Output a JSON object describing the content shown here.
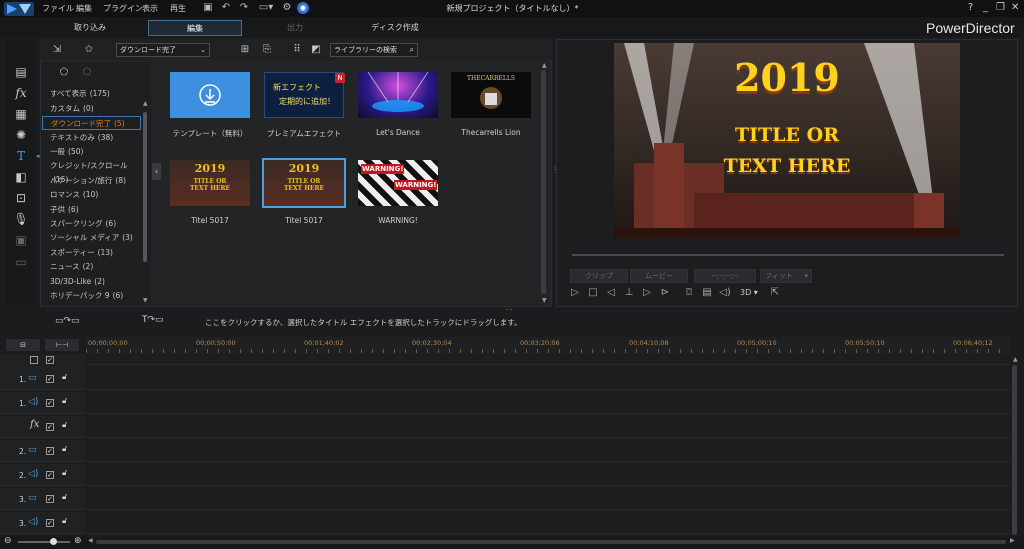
{
  "window": {
    "menu": [
      "ファイル",
      "編集",
      "プラグイン",
      "表示",
      "再生"
    ],
    "title": "新規プロジェクト（タイトルなし）*",
    "controls": [
      "?",
      "_",
      "❐",
      "✕"
    ]
  },
  "modes": {
    "capture": "取り込み",
    "edit": "編集",
    "produce": "出力",
    "disc": "ディスク作成"
  },
  "brand": "PowerDirector",
  "library": {
    "dropdown": "ダウンロード完了",
    "search_placeholder": "ライブラリーの検索",
    "categories": [
      {
        "label": "すべて表示",
        "count": "(175)"
      },
      {
        "label": "カスタム",
        "count": "(0)"
      },
      {
        "label": "ダウンロード完了",
        "count": "(5)",
        "selected": true
      },
      {
        "label": "テキストのみ",
        "count": "(38)"
      },
      {
        "label": "一般",
        "count": "(50)"
      },
      {
        "label": "クレジット/スクロール",
        "count": "(15)"
      },
      {
        "label": "バケーション/旅行",
        "count": "(8)"
      },
      {
        "label": "ロマンス",
        "count": "(10)"
      },
      {
        "label": "子供",
        "count": "(6)"
      },
      {
        "label": "スパークリング",
        "count": "(6)"
      },
      {
        "label": "ソーシャル メディア",
        "count": "(3)"
      },
      {
        "label": "スポーティー",
        "count": "(13)"
      },
      {
        "label": "ニュース",
        "count": "(2)"
      },
      {
        "label": "3D/3D-Like",
        "count": "(2)"
      },
      {
        "label": "ホリデーパック 9",
        "count": "(6)"
      }
    ],
    "items": [
      {
        "label": "テンプレート（無料）"
      },
      {
        "label": "プレミアムエフェクト",
        "line1": "新エフェクト",
        "line2": "定期的に追加！",
        "badge": "N"
      },
      {
        "label": "Let's Dance"
      },
      {
        "label": "Thecarrells Lion",
        "thumb_text": "THECARRELLS"
      },
      {
        "label": "Titel 5017",
        "thumb_text": [
          "2019",
          "TITLE OR",
          "TEXT HERE"
        ]
      },
      {
        "label": "Titel 5017",
        "thumb_text": [
          "2019",
          "TITLE OR",
          "TEXT HERE"
        ]
      },
      {
        "label": "WARNING!",
        "thumb_text": "WARNING!"
      }
    ]
  },
  "preview": {
    "year": "2019",
    "line1": "TITLE OR",
    "line2": "TEXT HERE",
    "clip_btn": "クリップ",
    "movie_btn": "ムービー",
    "timecode": "--;--;--;--",
    "fit": "フィット",
    "mode_3d": "3D"
  },
  "timeline": {
    "hint": "ここをクリックするか、選択したタイトル エフェクトを選択したトラックにドラッグします。",
    "ruler": [
      "00;00;00;00",
      "00;00;50;00",
      "00;01;40;02",
      "00;02;30;04",
      "00;03;20;06",
      "00;04;10;08",
      "00;05;00;10",
      "00;05;50;10",
      "00;06;40;12"
    ],
    "tracks": [
      {
        "num": "1.",
        "type": "video"
      },
      {
        "num": "1.",
        "type": "audio"
      },
      {
        "num": "",
        "type": "fx",
        "label": "fx"
      },
      {
        "num": "2.",
        "type": "video"
      },
      {
        "num": "2.",
        "type": "audio"
      },
      {
        "num": "3.",
        "type": "video"
      },
      {
        "num": "3.",
        "type": "audio"
      }
    ]
  },
  "colors": {
    "accent_blue": "#3b79b5",
    "selected_category_text": "#e57c2c",
    "ruler_text": "#b58a4a",
    "track_icon": "#4e9de0"
  }
}
